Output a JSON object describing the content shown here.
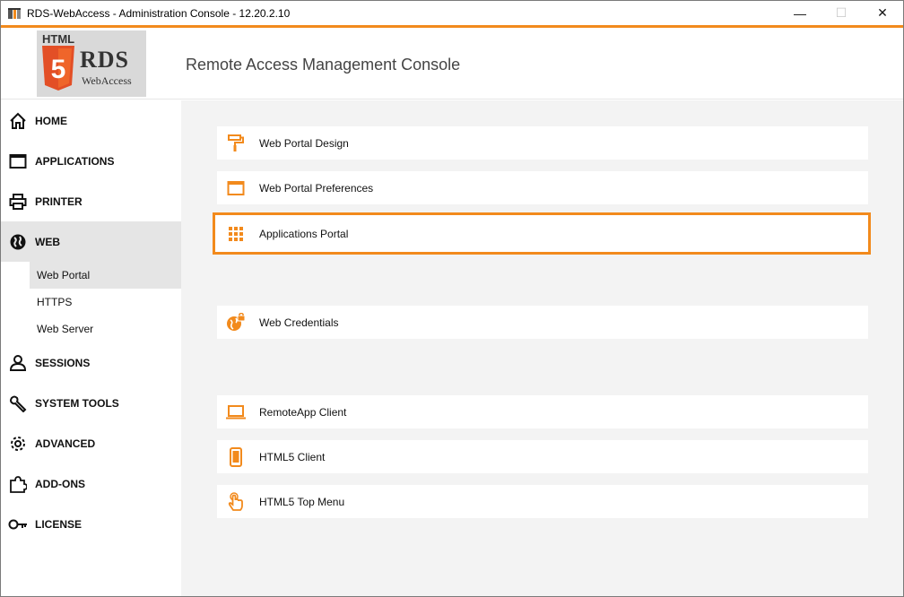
{
  "window": {
    "title": "RDS-WebAccess - Administration Console - 12.20.2.10",
    "controls": {
      "minimize": "—",
      "maximize": "☐",
      "close": "✕"
    }
  },
  "header": {
    "logo": {
      "html_word": "HTML",
      "shield_digit": "5",
      "rds": "RDS",
      "webaccess": "WebAccess"
    },
    "title": "Remote Access Management Console"
  },
  "sidebar": {
    "items": [
      {
        "label": "HOME",
        "icon": "home-icon"
      },
      {
        "label": "APPLICATIONS",
        "icon": "window-icon"
      },
      {
        "label": "PRINTER",
        "icon": "printer-icon"
      },
      {
        "label": "WEB",
        "icon": "globe-icon",
        "active": true
      },
      {
        "label": "SESSIONS",
        "icon": "user-icon"
      },
      {
        "label": "SYSTEM TOOLS",
        "icon": "wrench-icon"
      },
      {
        "label": "ADVANCED",
        "icon": "gear-icon"
      },
      {
        "label": "ADD-ONS",
        "icon": "puzzle-icon"
      },
      {
        "label": "LICENSE",
        "icon": "key-icon"
      }
    ],
    "web_subitems": [
      {
        "label": "Web Portal",
        "active": true
      },
      {
        "label": "HTTPS"
      },
      {
        "label": "Web Server"
      }
    ]
  },
  "main": {
    "cards": [
      {
        "label": "Web Portal Design",
        "icon": "paint-roller-icon"
      },
      {
        "label": "Web Portal Preferences",
        "icon": "window-icon"
      },
      {
        "label": "Applications Portal",
        "icon": "grid-icon",
        "selected": true
      },
      {
        "label": "Web Credentials",
        "icon": "globe-lock-icon"
      },
      {
        "label": "RemoteApp Client",
        "icon": "laptop-icon"
      },
      {
        "label": "HTML5 Client",
        "icon": "phone-icon"
      },
      {
        "label": "HTML5 Top Menu",
        "icon": "hand-pointer-icon"
      }
    ]
  },
  "colors": {
    "accent": "#f28a1c",
    "main_bg": "#f3f3f3",
    "active_nav_bg": "#e5e5e5"
  }
}
